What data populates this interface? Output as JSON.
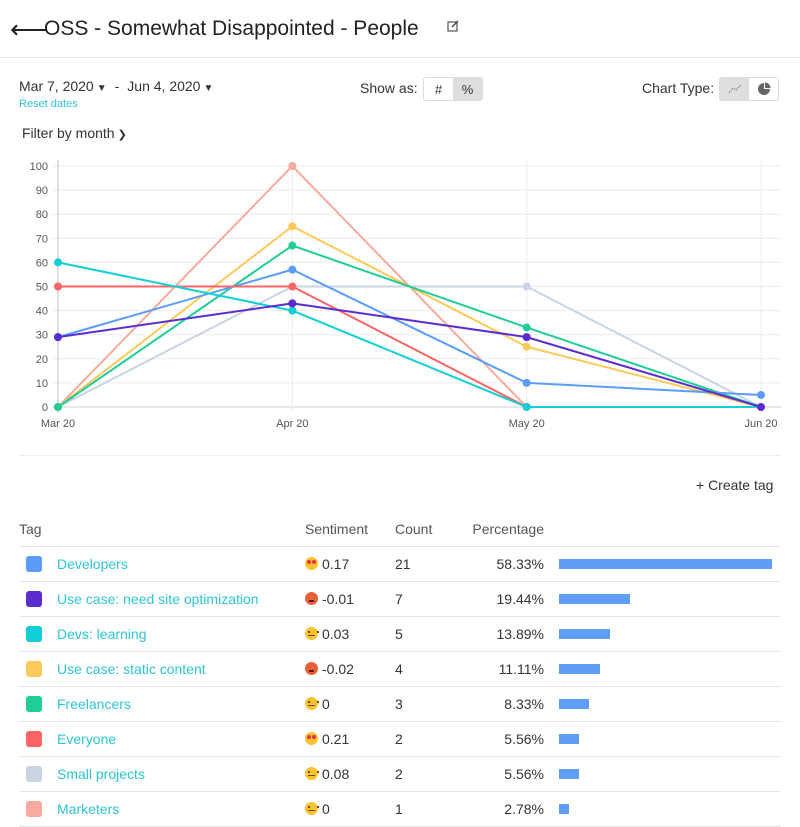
{
  "header": {
    "back_icon": "arrow-left-icon",
    "title": "OSS - Somewhat Disappointed - People",
    "edit_icon": "edit-icon"
  },
  "filters": {
    "start_date": "Mar 7, 2020",
    "end_date": "Jun 4, 2020",
    "date_separator": "-",
    "reset_label": "Reset dates",
    "filter_label": "Filter by month",
    "show_as_label": "Show as:",
    "show_as_options": [
      "#",
      "%"
    ],
    "show_as_selected": "%",
    "chart_type_label": "Chart Type:",
    "chart_type_options": [
      "line-chart-icon",
      "pie-chart-icon"
    ],
    "chart_type_selected": "line"
  },
  "actions": {
    "create_tag": "+ Create tag"
  },
  "table": {
    "headers": [
      "Tag",
      "Sentiment",
      "Count",
      "Percentage"
    ],
    "rows": [
      {
        "tag": "Developers",
        "color": "#5b9cf8",
        "sentiment_icon": "love",
        "sentiment": "0.17",
        "count": "21",
        "percentage": "58.33%",
        "pct_value": 58.33
      },
      {
        "tag": "Use case: need site optimization",
        "color": "#5a2dd0",
        "sentiment_icon": "angry",
        "sentiment": "-0.01",
        "count": "7",
        "percentage": "19.44%",
        "pct_value": 19.44
      },
      {
        "tag": "Devs: learning",
        "color": "#12cfd6",
        "sentiment_icon": "neutral",
        "sentiment": "0.03",
        "count": "5",
        "percentage": "13.89%",
        "pct_value": 13.89
      },
      {
        "tag": "Use case: static content",
        "color": "#fdc95a",
        "sentiment_icon": "angry",
        "sentiment": "-0.02",
        "count": "4",
        "percentage": "11.11%",
        "pct_value": 11.11
      },
      {
        "tag": "Freelancers",
        "color": "#20cd98",
        "sentiment_icon": "neutral",
        "sentiment": "0",
        "count": "3",
        "percentage": "8.33%",
        "pct_value": 8.33
      },
      {
        "tag": "Everyone",
        "color": "#fc6466",
        "sentiment_icon": "love",
        "sentiment": "0.21",
        "count": "2",
        "percentage": "5.56%",
        "pct_value": 5.56
      },
      {
        "tag": "Small projects",
        "color": "#c8d4e3",
        "sentiment_icon": "neutral",
        "sentiment": "0.08",
        "count": "2",
        "percentage": "5.56%",
        "pct_value": 5.56
      },
      {
        "tag": "Marketers",
        "color": "#f8ab9c",
        "sentiment_icon": "neutral",
        "sentiment": "0",
        "count": "1",
        "percentage": "2.78%",
        "pct_value": 2.78
      }
    ],
    "bar_color": "#5f9ef6"
  },
  "chart_data": {
    "type": "line",
    "title": "",
    "xlabel": "",
    "ylabel": "",
    "categories": [
      "Mar 20",
      "Apr 20",
      "May 20",
      "Jun 20"
    ],
    "yticks": [
      "0",
      "10",
      "20",
      "30",
      "40",
      "50",
      "60",
      "70",
      "80",
      "90",
      "100"
    ],
    "ylim": [
      0,
      100
    ],
    "grid": true,
    "legend": "none",
    "series": [
      {
        "name": "Small projects",
        "color": "#c8d4e3",
        "values": [
          0,
          50,
          50,
          0
        ],
        "markers": [
          true,
          false,
          true,
          false
        ]
      },
      {
        "name": "Marketers",
        "color": "#f8ab9c",
        "values": [
          0,
          100,
          0,
          0
        ],
        "markers": [
          true,
          true,
          true,
          false
        ]
      },
      {
        "name": "Use case: static content",
        "color": "#fdc95a",
        "values": [
          0,
          75,
          25,
          0
        ],
        "markers": [
          true,
          true,
          true,
          false
        ]
      },
      {
        "name": "Freelancers",
        "color": "#20cd98",
        "values": [
          0,
          67,
          33,
          0
        ],
        "markers": [
          true,
          true,
          true,
          false
        ]
      },
      {
        "name": "Developers",
        "color": "#5b9cf8",
        "values": [
          29,
          57,
          10,
          5
        ],
        "markers": [
          true,
          true,
          true,
          true
        ]
      },
      {
        "name": "Everyone",
        "color": "#fc6466",
        "values": [
          50,
          50,
          0,
          0
        ],
        "markers": [
          true,
          true,
          true,
          false
        ]
      },
      {
        "name": "Devs: learning",
        "color": "#12cfd6",
        "values": [
          60,
          40,
          0,
          0
        ],
        "markers": [
          true,
          true,
          true,
          false
        ]
      },
      {
        "name": "Use case: need site optimization",
        "color": "#5a2dd0",
        "values": [
          29,
          43,
          29,
          0
        ],
        "markers": [
          true,
          true,
          true,
          true
        ]
      }
    ]
  }
}
